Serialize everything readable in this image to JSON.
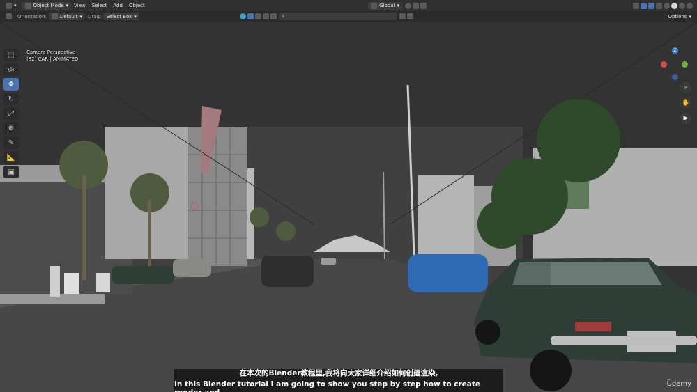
{
  "header": {
    "mode": "Object Mode",
    "menus": [
      "View",
      "Select",
      "Add",
      "Object"
    ],
    "transform_orientation": "Global",
    "options_label": "Options"
  },
  "tool_header": {
    "orientation_label": "Orientation:",
    "orientation_value": "Default",
    "drag_label": "Drag:",
    "drag_value": "Select Box"
  },
  "toolbar": {
    "tools": [
      {
        "name": "select-box",
        "icon": "cursor-icon",
        "glyph": "⬚",
        "active": false
      },
      {
        "name": "cursor",
        "icon": "crosshair-icon",
        "glyph": "◎",
        "active": false
      },
      {
        "name": "move",
        "icon": "move-icon",
        "glyph": "✥",
        "active": true
      },
      {
        "name": "rotate",
        "icon": "rotate-icon",
        "glyph": "↻",
        "active": false
      },
      {
        "name": "scale",
        "icon": "scale-icon",
        "glyph": "⤢",
        "active": false
      },
      {
        "name": "transform",
        "icon": "transform-icon",
        "glyph": "⊕",
        "active": false
      },
      {
        "name": "annotate",
        "icon": "pencil-icon",
        "glyph": "✎",
        "active": false
      },
      {
        "name": "measure",
        "icon": "ruler-icon",
        "glyph": "📐",
        "active": false
      },
      {
        "name": "add-cube",
        "icon": "cube-icon",
        "glyph": "▣",
        "active": false
      }
    ]
  },
  "viewport": {
    "view_name": "Camera Perspective",
    "collection_info": "(82) CAR | ANIMATED"
  },
  "gizmo": {
    "axes": [
      "Z",
      "X",
      "Y"
    ],
    "colors": {
      "x": "#e04a4a",
      "y": "#6db33f",
      "z": "#3f7fd6"
    }
  },
  "subtitle": {
    "line_zh": "在本次的Blender教程里,我将向大家详细介绍如何创建渲染,",
    "line_en": "In this Blender tutorial I am going to show you step by step how to create render and,"
  },
  "watermark": "Ûdemy"
}
